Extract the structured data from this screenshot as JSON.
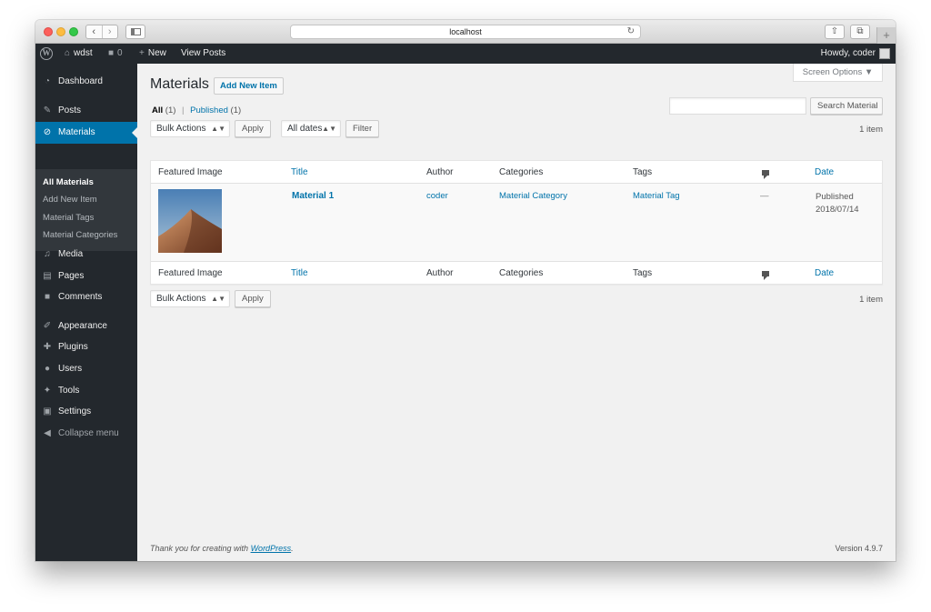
{
  "browser": {
    "url": "localhost",
    "back_icon": "‹",
    "forward_icon": "›",
    "reload_icon": "↻",
    "share_icon": "⇧",
    "tabs_icon": "⧉",
    "new_tab_icon": "+"
  },
  "admin_bar": {
    "site_name": "wdst",
    "comments_count": "0",
    "new_label": "New",
    "view_posts_label": "View Posts",
    "howdy_label": "Howdy, coder"
  },
  "menu": {
    "items": [
      {
        "label": "Dashboard",
        "icon": "dashboard-icon"
      },
      {
        "label": "Posts",
        "icon": "pin-icon"
      },
      {
        "label": "Materials",
        "icon": "paperclip-icon"
      },
      {
        "label": "Media",
        "icon": "media-icon"
      },
      {
        "label": "Pages",
        "icon": "page-icon"
      },
      {
        "label": "Comments",
        "icon": "comment-icon"
      },
      {
        "label": "Appearance",
        "icon": "brush-icon"
      },
      {
        "label": "Plugins",
        "icon": "plug-icon"
      },
      {
        "label": "Users",
        "icon": "user-icon"
      },
      {
        "label": "Tools",
        "icon": "wrench-icon"
      },
      {
        "label": "Settings",
        "icon": "settings-icon"
      },
      {
        "label": "Collapse menu",
        "icon": "collapse-icon"
      }
    ],
    "submenu": [
      "All Materials",
      "Add New Item",
      "Material Tags",
      "Material Categories"
    ]
  },
  "page": {
    "screen_options": "Screen Options ▼",
    "title": "Materials",
    "add_new": "Add New Item",
    "filter_all": "All",
    "filter_all_count": "(1)",
    "filter_sep": "|",
    "filter_published": "Published",
    "filter_published_count": "(1)",
    "search_placeholder": "",
    "search_button": "Search Material",
    "bulk_actions": "Bulk Actions",
    "apply": "Apply",
    "all_dates": "All dates",
    "filter_button": "Filter",
    "item_count": "1 item"
  },
  "table": {
    "columns": {
      "featured_image": "Featured Image",
      "title": "Title",
      "author": "Author",
      "categories": "Categories",
      "tags": "Tags",
      "date": "Date"
    },
    "rows": [
      {
        "title": "Material 1",
        "author": "coder",
        "categories": "Material Category",
        "tags": "Material Tag",
        "comments": "—",
        "date_status": "Published",
        "date": "2018/07/14"
      }
    ]
  },
  "footer": {
    "thanks_prefix": "Thank you for creating with ",
    "thanks_link": "WordPress",
    "thanks_suffix": ".",
    "version": "Version 4.9.7"
  },
  "colors": {
    "admin_dark": "#23282d",
    "submenu_bg": "#32373c",
    "accent": "#0073aa",
    "content_bg": "#f1f1f1"
  }
}
